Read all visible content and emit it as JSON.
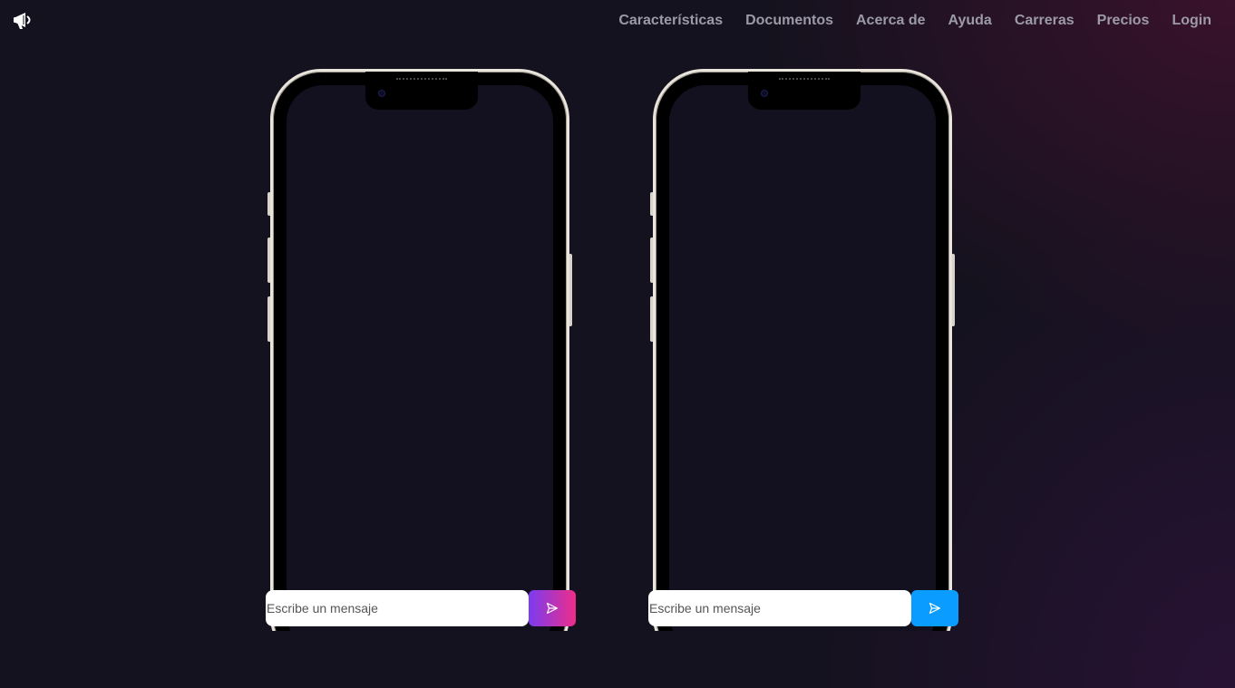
{
  "header": {
    "logo_icon": "megaphone-icon",
    "nav": [
      {
        "label": "Características"
      },
      {
        "label": "Documentos"
      },
      {
        "label": "Acerca de"
      },
      {
        "label": "Ayuda"
      },
      {
        "label": "Carreras"
      },
      {
        "label": "Precios"
      },
      {
        "label": "Login"
      }
    ]
  },
  "phones": [
    {
      "input_placeholder": "Escribe un mensaje",
      "send_icon": "send-icon",
      "send_colors": [
        "#7a3cf0",
        "#ee2d8a"
      ]
    },
    {
      "input_placeholder": "Escribe un mensaje",
      "send_icon": "send-icon",
      "send_colors": [
        "#0a9cff",
        "#0a9cff"
      ]
    }
  ]
}
